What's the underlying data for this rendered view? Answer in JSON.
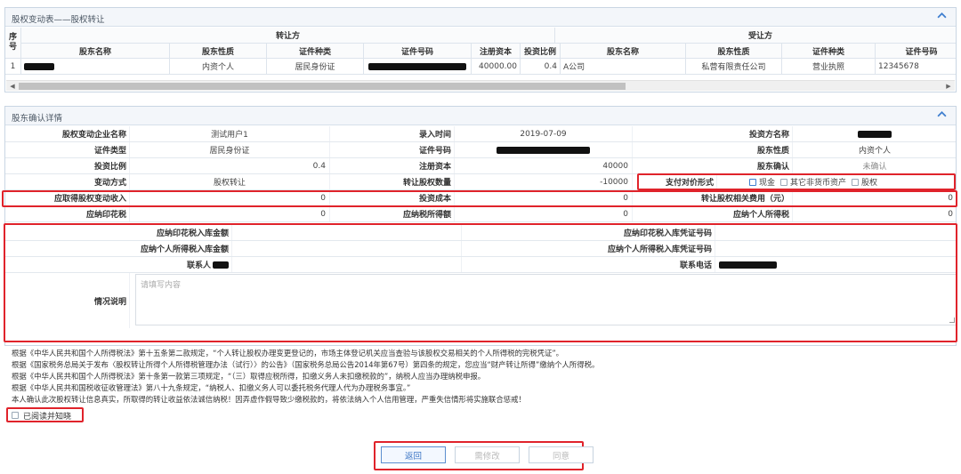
{
  "transfer_panel": {
    "title": "股权变动表——股权转让",
    "seq_header": "序号",
    "group_headers": {
      "transferor": "转让方",
      "transferee": "受让方"
    },
    "columns": [
      "股东名称",
      "股东性质",
      "证件种类",
      "证件号码",
      "注册资本",
      "投资比例",
      "股东名称",
      "股东性质",
      "证件种类",
      "证件号码"
    ],
    "row": {
      "seq": "1",
      "transferor_nature": "内资个人",
      "transferor_id_type": "居民身份证",
      "registered_capital": "40000.00",
      "ratio": "0.4",
      "transferee_name": "A公司",
      "transferee_nature": "私营有限责任公司",
      "transferee_id_type": "营业执照",
      "transferee_id_no": "12345678"
    }
  },
  "confirm_panel": {
    "title": "股东确认详情",
    "fields": {
      "change_company_label": "股权变动企业名称",
      "change_company_value": "测试用户1",
      "entry_time_label": "录入时间",
      "entry_time_value": "2019-07-09",
      "investor_name_label": "投资方名称",
      "id_type_label": "证件类型",
      "id_type_value": "居民身份证",
      "id_no_label": "证件号码",
      "shareholder_nature_label": "股东性质",
      "shareholder_nature_value": "内资个人",
      "invest_ratio_label": "投资比例",
      "invest_ratio_value": "0.4",
      "reg_capital_label": "注册资本",
      "reg_capital_value": "40000",
      "confirm_label": "股东确认",
      "confirm_value": "未确认",
      "change_method_label": "变动方式",
      "change_method_value": "股权转让",
      "transfer_qty_label": "转让股权数量",
      "transfer_qty_value": "-10000",
      "payment_label": "支付对价形式",
      "payment_options": [
        "现金",
        "其它非货币资产",
        "股权"
      ],
      "income_label": "应取得股权变动收入",
      "income_value": "0",
      "invest_cost_label": "投资成本",
      "invest_cost_value": "0",
      "fees_label": "转让股权相关费用（元）",
      "fees_value": "0",
      "stamp_tax_label": "应纳印花税",
      "stamp_tax_value": "0",
      "income_tax_label": "应纳税所得额",
      "income_tax_value": "0",
      "personal_tax_label": "应纳个人所得税",
      "personal_tax_value": "0",
      "stamp_paid_label": "应纳印花税入库金额",
      "stamp_voucher_label": "应纳印花税入库凭证号码",
      "personal_paid_label": "应纳个人所得税入库金额",
      "personal_voucher_label": "应纳个人所得税入库凭证号码",
      "contact_label": "联系人",
      "phone_label": "联系电话",
      "remark_label": "情况说明",
      "remark_placeholder": "请填写内容"
    }
  },
  "notes": [
    "根据《中华人民共和国个人所得税法》第十五条第二款规定，“个人转让股权办理变更登记的，市场主体登记机关应当查验与该股权交易相关的个人所得税的完税凭证”。",
    "根据《国家税务总局关于发布〈股权转让所得个人所得税管理办法（试行）〉的公告》（国家税务总局公告2014年第67号）第四条的规定，您应当“财产转让所得”缴纳个人所得税。",
    "根据《中华人民共和国个人所得税法》第十条第一款第三项规定，“（三）取得应税所得，扣缴义务人未扣缴税款的”，纳税人应当办理纳税申报。",
    "根据《中华人民共和国税收征收管理法》第八十九条规定，“纳税人、扣缴义务人可以委托税务代理人代为办理税务事宜。”",
    "本人确认此次股权转让信息真实，所取得的转让收益依法诚信纳税！因弄虚作假导致少缴税款的，将依法纳入个人信用管理，严重失信情形将实施联合惩戒！"
  ],
  "ack_label": "已阅读并知晓",
  "buttons": {
    "back": "返回",
    "modify": "需修改",
    "agree": "同意"
  },
  "colors": {
    "highlight": "#e0232b",
    "accent": "#3f7fcf"
  }
}
